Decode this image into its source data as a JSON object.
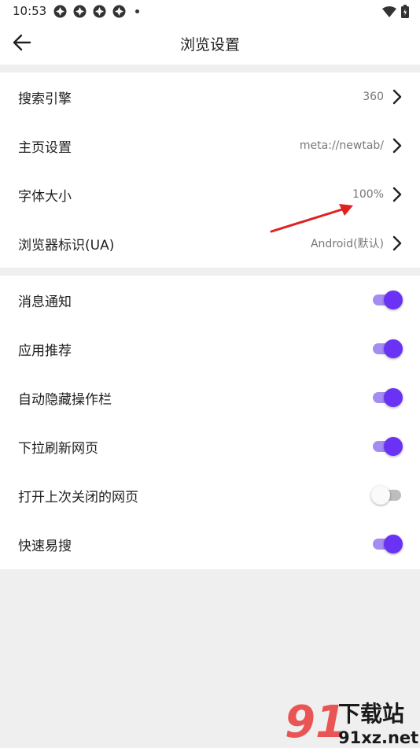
{
  "status_bar": {
    "time": "10:53"
  },
  "header": {
    "title": "浏览设置"
  },
  "general_settings": [
    {
      "label": "搜索引擎",
      "value": "360"
    },
    {
      "label": "主页设置",
      "value": "meta://newtab/"
    },
    {
      "label": "字体大小",
      "value": "100%"
    },
    {
      "label": "浏览器标识(UA)",
      "value": "Android(默认)"
    }
  ],
  "toggle_settings": [
    {
      "label": "消息通知",
      "on": true
    },
    {
      "label": "应用推荐",
      "on": true
    },
    {
      "label": "自动隐藏操作栏",
      "on": true
    },
    {
      "label": "下拉刷新网页",
      "on": true
    },
    {
      "label": "打开上次关闭的网页",
      "on": false
    },
    {
      "label": "快速易搜",
      "on": true
    }
  ],
  "colors": {
    "accent": "#6a32f5",
    "accent_track": "#a58cf2",
    "annotation_arrow": "#e02020"
  },
  "watermark": {
    "brand": "下载站",
    "domain": "91xz.net"
  }
}
